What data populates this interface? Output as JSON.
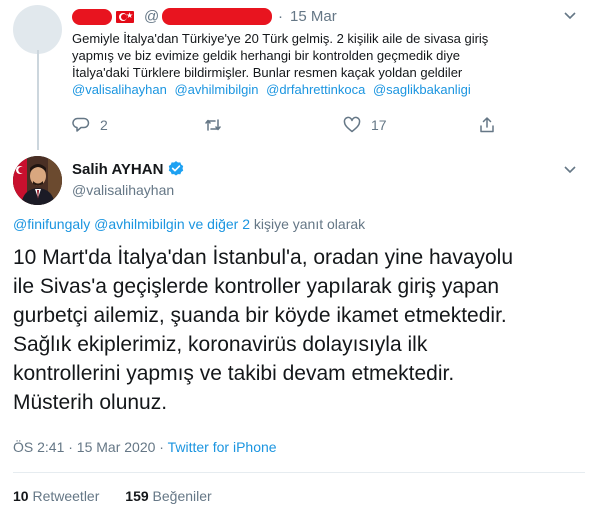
{
  "reply_tweet": {
    "handle_prefix": "@",
    "separator": "·",
    "date": "15 Mar",
    "text_lines": [
      "Gemiyle İtalya'dan Türkiye'ye 20 Türk gelmiş. 2 kişilik aile de sivasa giriş",
      "yapmış ve biz evimize geldik herhangi bir kontrolden geçmedik diye",
      "İtalya'daki Türklere bildirmişler. Bunlar resmen kaçak yoldan geldiler"
    ],
    "mentions": [
      "@valisalihayhan",
      "@avhilmibilgin",
      "@drfahrettinkoca",
      "@saglikbakanligi"
    ],
    "reply_count": "2",
    "retweet_count": "",
    "like_count": "17",
    "colors": {
      "redaction": "#e8141f",
      "flag": "#e30a17"
    }
  },
  "main_tweet": {
    "name": "Salih AYHAN",
    "handle": "@valisalihayhan",
    "replying_to": {
      "users": "@finifungaly @avhilmibilgin ve diğer 2",
      "suffix": " kişiye yanıt olarak"
    },
    "text_lines": [
      "10 Mart'da İtalya'dan İstanbul'a, oradan yine havayolu",
      "ile Sivas'a geçişlerde kontroller yapılarak giriş yapan",
      "gurbetçi ailemiz, şuanda bir köyde ikamet etmektedir.",
      "Sağlık ekiplerimiz, koronavirüs dolayısıyla ilk",
      "kontrollerini yapmış ve takibi devam etmektedir.",
      "Müsterih olunuz."
    ],
    "timestamp": "ÖS 2:41 · 15 Mar 2020 · ",
    "source": "Twitter for iPhone",
    "retweets_count": "10",
    "retweets_label": " Retweetler",
    "likes_count": "159",
    "likes_label": " Beğeniler"
  },
  "icons": [
    "reply-icon",
    "retweet-icon",
    "like-icon",
    "share-icon",
    "verified-badge-icon",
    "chevron-down-icon"
  ],
  "colors": {
    "link": "#1b95e0",
    "muted": "#657786",
    "text": "#14171a",
    "verified": "#1da1f2"
  }
}
